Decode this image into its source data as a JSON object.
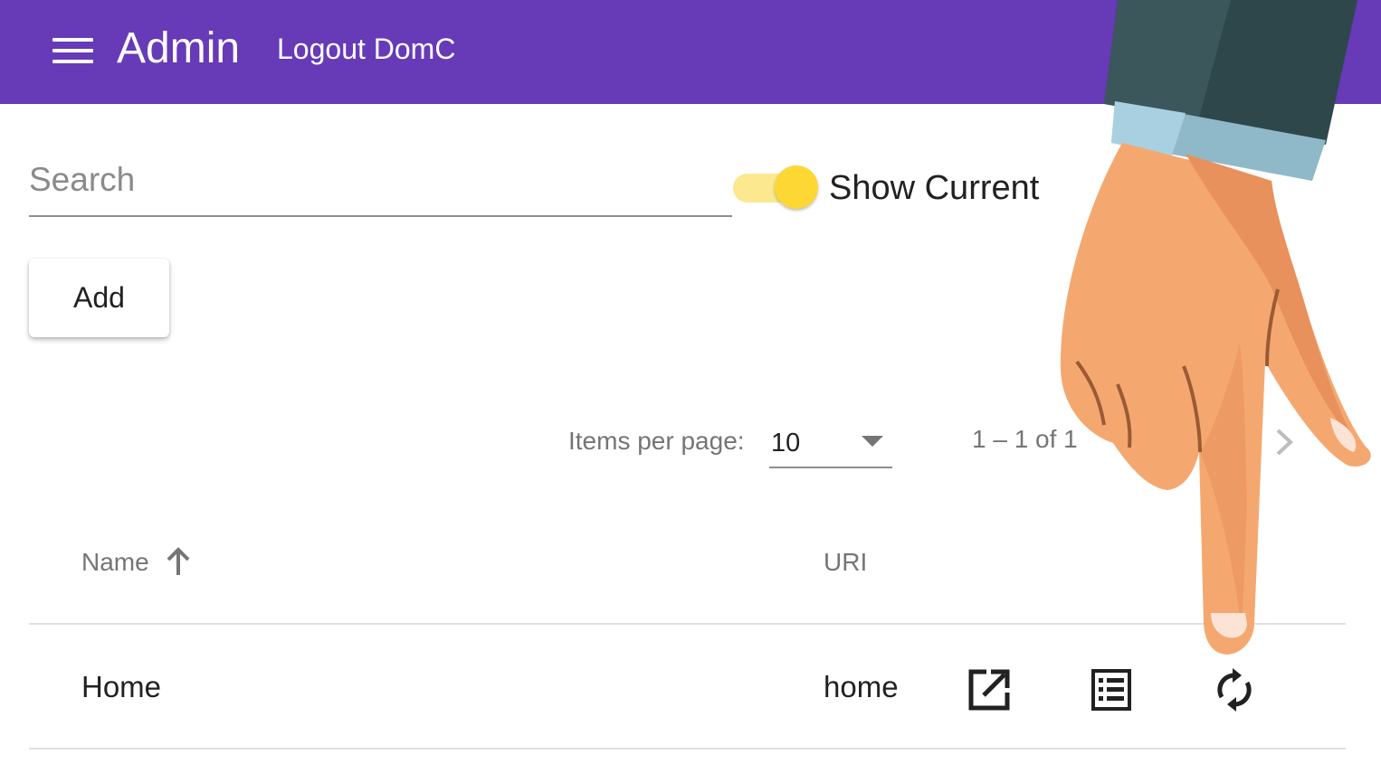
{
  "toolbar": {
    "title": "Admin",
    "logout_label": "Logout DomC",
    "menu_icon": "menu-icon",
    "background": "#673ab7"
  },
  "filters": {
    "search_placeholder": "Search",
    "search_value": "",
    "toggle_label": "Show Current",
    "toggle_on": true,
    "toggle_color": "#fdd835"
  },
  "actions": {
    "add_label": "Add"
  },
  "paginator": {
    "items_per_page_label": "Items per page:",
    "items_per_page_value": "10",
    "range_label": "1 – 1 of 1",
    "next_icon": "chevron-right-icon"
  },
  "table": {
    "columns": [
      {
        "label": "Name",
        "sort": "ascending",
        "sort_icon": "arrow-up-icon"
      },
      {
        "label": "URI"
      }
    ],
    "rows": [
      {
        "name": "Home",
        "uri": "home",
        "action_icons": [
          "open-in-new-icon",
          "list-icon",
          "refresh-icon"
        ]
      }
    ]
  },
  "overlay": {
    "pointer_icon": "pointing-hand-icon"
  }
}
